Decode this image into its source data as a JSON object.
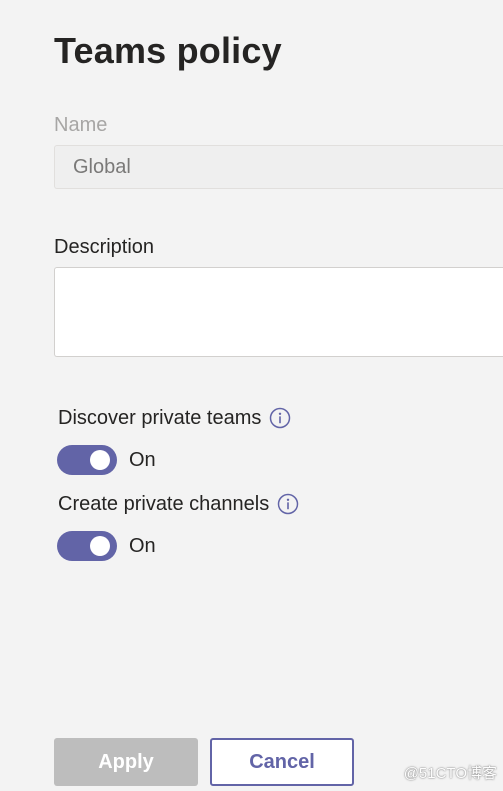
{
  "header": {
    "title": "Teams policy"
  },
  "form": {
    "name": {
      "label": "Name",
      "value": "Global"
    },
    "description": {
      "label": "Description",
      "value": ""
    }
  },
  "settings": [
    {
      "label": "Discover private teams",
      "info_icon": "info-icon",
      "state": "On",
      "enabled": true
    },
    {
      "label": "Create private channels",
      "info_icon": "info-icon",
      "state": "On",
      "enabled": true
    }
  ],
  "footer": {
    "apply_label": "Apply",
    "cancel_label": "Cancel"
  },
  "watermark": {
    "text": "@51CTO博客"
  },
  "colors": {
    "accent": "#6264a7",
    "background": "#f3f3f3",
    "disabled_button": "#bdbdbd"
  }
}
